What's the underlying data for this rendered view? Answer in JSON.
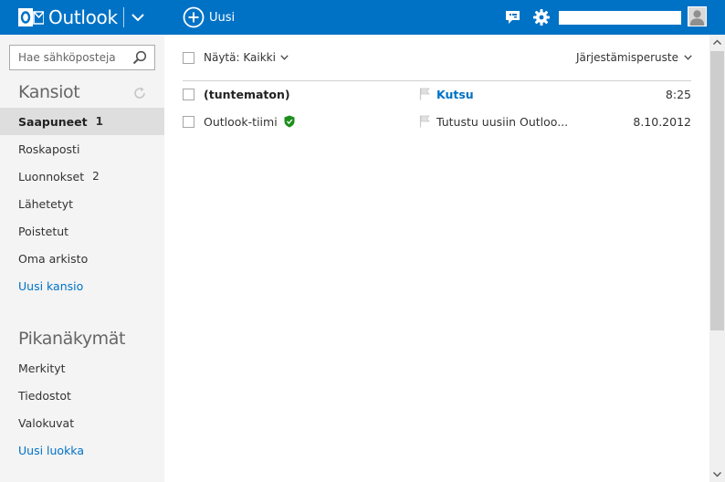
{
  "topbar": {
    "app_name": "Outlook",
    "new_label": "Uusi",
    "account_name": "",
    "colors": {
      "background": "#0072c6",
      "text": "#ffffff"
    },
    "icons": [
      "outlook-logo-icon",
      "chevron-down-icon",
      "plus-circle-icon",
      "chat-icon",
      "gear-icon",
      "avatar-icon"
    ]
  },
  "sidebar": {
    "search_placeholder": "Hae sähköposteja",
    "folders_heading": "Kansiot",
    "folders": [
      {
        "label": "Saapuneet",
        "count": "1",
        "selected": true
      },
      {
        "label": "Roskaposti",
        "count": ""
      },
      {
        "label": "Luonnokset",
        "count": "2"
      },
      {
        "label": "Lähetetyt",
        "count": ""
      },
      {
        "label": "Poistetut",
        "count": ""
      },
      {
        "label": "Oma arkisto",
        "count": ""
      }
    ],
    "new_folder_label": "Uusi kansio",
    "quick_views_heading": "Pikanäkymät",
    "quick_views": [
      {
        "label": "Merkityt"
      },
      {
        "label": "Tiedostot"
      },
      {
        "label": "Valokuvat"
      }
    ],
    "new_category_label": "Uusi luokka",
    "colors": {
      "background": "#f4f4f4",
      "selected": "#dedede",
      "link": "#0072c6"
    }
  },
  "toolbar": {
    "filter_label": "Näytä: Kaikki",
    "sort_label": "Järjestämisperuste"
  },
  "messages": [
    {
      "sender": "(tuntematon)",
      "subject": "Kutsu",
      "date": "8:25",
      "unread": true,
      "verified": false
    },
    {
      "sender": "Outlook-tiimi",
      "subject": "Tutustu uusiin Outloo...",
      "date": "8.10.2012",
      "unread": false,
      "verified": true
    }
  ]
}
